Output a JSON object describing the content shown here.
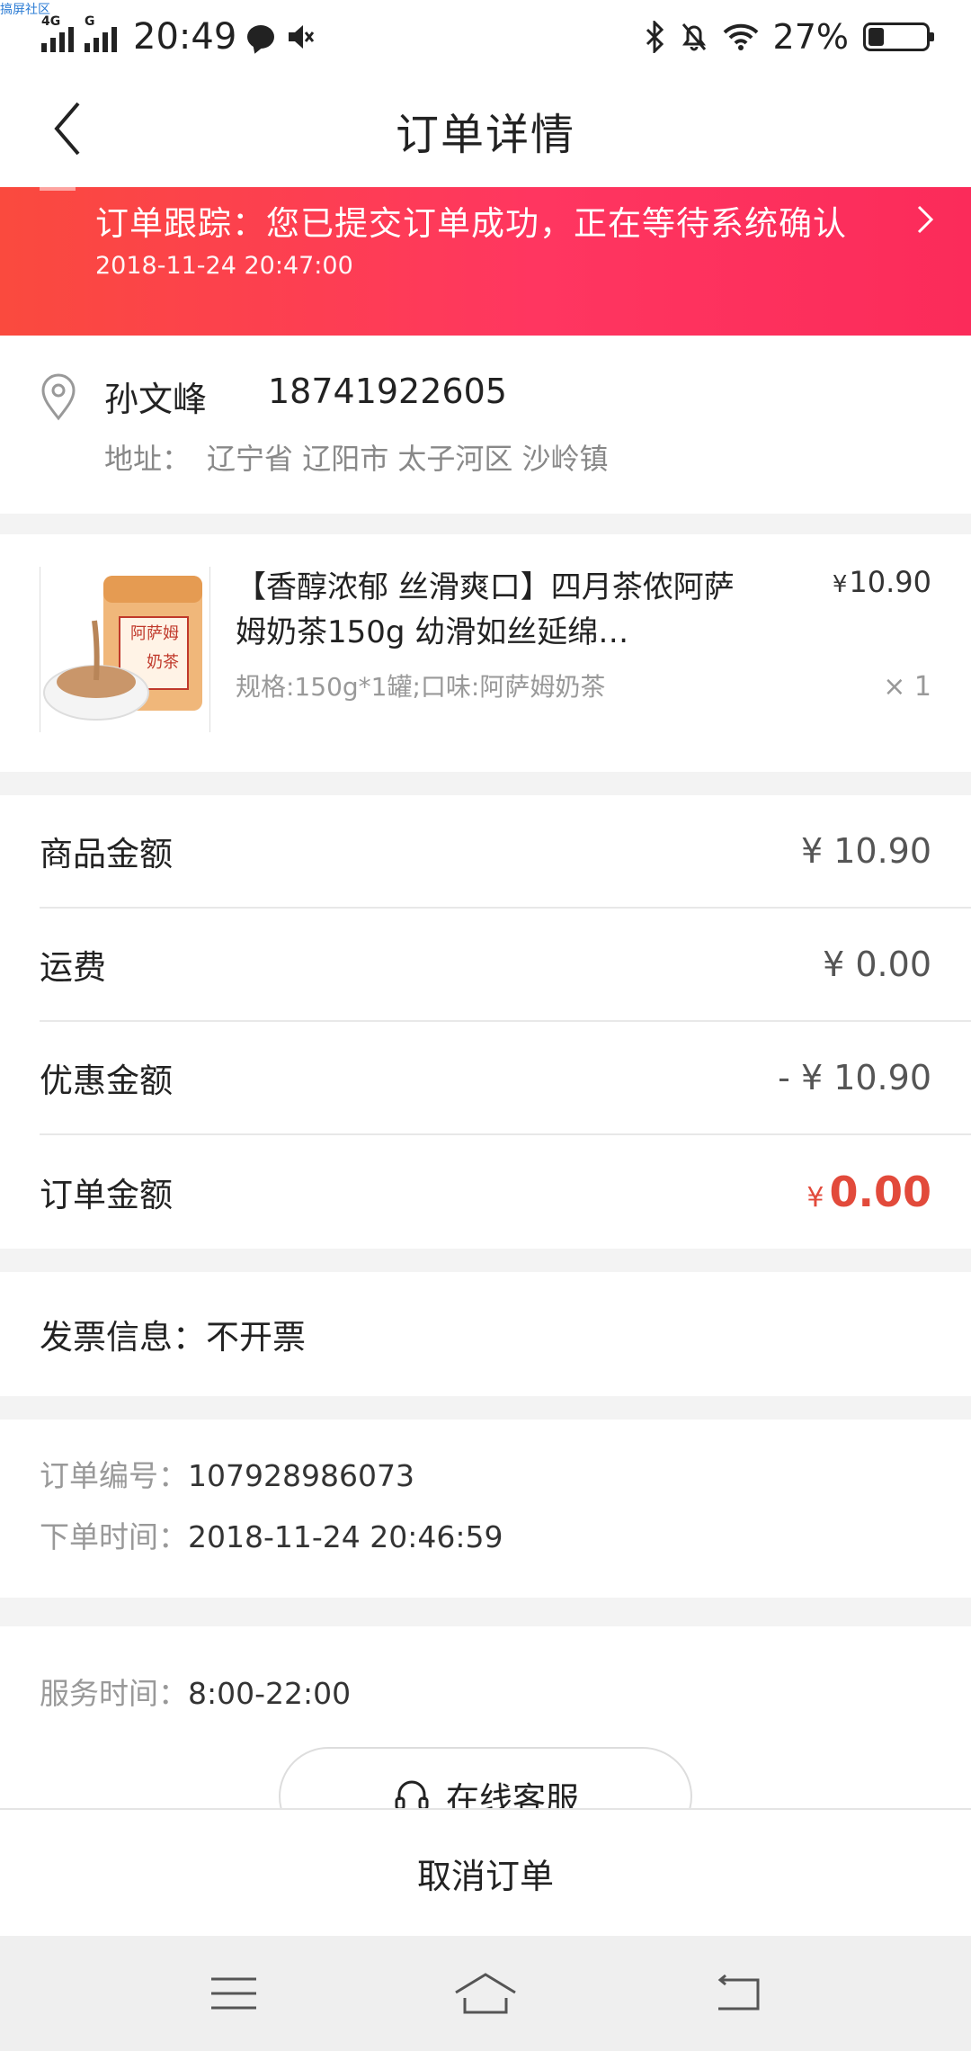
{
  "watermark": "搞屏社区",
  "status_bar": {
    "network_1": "4G",
    "network_2": "G",
    "time": "20:49",
    "battery_percent": "27%",
    "battery_level": 0.27
  },
  "header": {
    "title": "订单详情"
  },
  "tracking": {
    "text": "订单跟踪：您已提交订单成功，正在等待系统确认",
    "time": "2018-11-24 20:47:00"
  },
  "address": {
    "name": "孙文峰",
    "phone": "18741922605",
    "label": "地址：",
    "value": "辽宁省 辽阳市 太子河区 沙岭镇"
  },
  "product": {
    "title": "【香醇浓郁 丝滑爽口】四月茶侬阿萨姆奶茶150g 幼滑如丝延绵…",
    "price_symbol": "¥",
    "price": "10.90",
    "spec": "规格:150g*1罐;口味:阿萨姆奶茶",
    "qty": "× 1",
    "image_label_1": "阿萨姆",
    "image_label_2": "奶茶"
  },
  "amounts": [
    {
      "label": "商品金额",
      "value": "¥ 10.90"
    },
    {
      "label": "运费",
      "value": "¥ 0.00"
    },
    {
      "label": "优惠金额",
      "value": "- ¥ 10.90"
    }
  ],
  "total": {
    "label": "订单金额",
    "symbol": "¥",
    "value": "0.00",
    "color": "#e24a3b"
  },
  "invoice": {
    "label": "发票信息：",
    "value": "不开票"
  },
  "order_info": {
    "number_label": "订单编号：",
    "number": "107928986073",
    "time_label": "下单时间：",
    "time": "2018-11-24 20:46:59"
  },
  "service": {
    "label": "服务时间：",
    "hours": "8:00-22:00",
    "button_label": "在线客服"
  },
  "action": {
    "cancel_label": "取消订单"
  },
  "colors": {
    "banner_start": "#fa4a3e",
    "banner_end": "#ff3660",
    "accent": "#e24a3b"
  }
}
